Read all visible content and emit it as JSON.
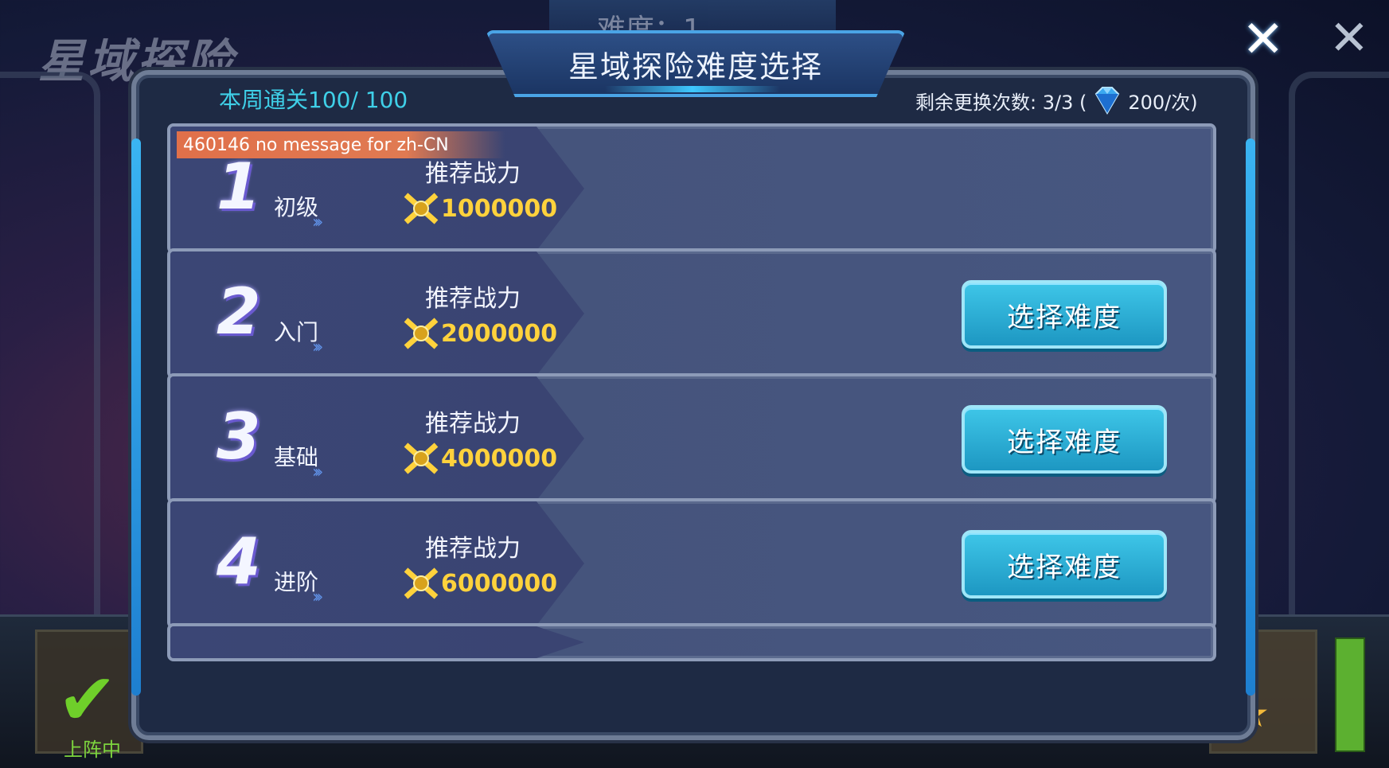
{
  "background": {
    "title": "星域探险",
    "top_tab": "难度：1",
    "onstage_label": "上阵中"
  },
  "dialog": {
    "title": "星域探险难度选择",
    "weekly_clear": "本周通关100/ 100",
    "swaps_label": "剩余更换次数: 3/3 (",
    "swaps_cost": "200/次)"
  },
  "rows": [
    {
      "num": "1",
      "level": "初级",
      "rec_label": "推荐战力",
      "power": "1000000",
      "tag": "460146 no message for zh-CN",
      "button": ""
    },
    {
      "num": "2",
      "level": "入门",
      "rec_label": "推荐战力",
      "power": "2000000",
      "button": "选择难度"
    },
    {
      "num": "3",
      "level": "基础",
      "rec_label": "推荐战力",
      "power": "4000000",
      "button": "选择难度"
    },
    {
      "num": "4",
      "level": "进阶",
      "rec_label": "推荐战力",
      "power": "6000000",
      "button": "选择难度"
    }
  ],
  "icons": {
    "close": "close-icon",
    "gem": "diamond-icon",
    "power": "crossed-swords-icon"
  },
  "colors": {
    "accent": "#3fd0e8",
    "power": "#ffd23c",
    "button": "#2bb0d8"
  }
}
